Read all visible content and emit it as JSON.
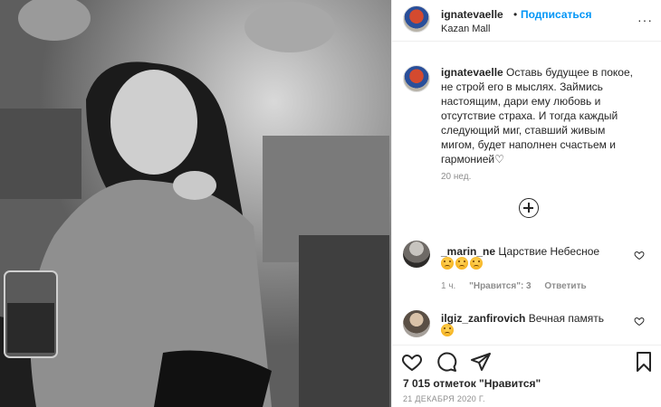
{
  "post": {
    "username": "ignatevaelle",
    "separator": "•",
    "follow_label": "Подписаться",
    "location": "Kazan Mall",
    "more_label": "···"
  },
  "caption": {
    "username": "ignatevaelle",
    "text": "Оставь будущее в покое, не строй его в мыслях. Займись настоящим, дари ему любовь и отсутствие страха. И тогда каждый следующий миг, ставший живым мигом, будет наполнен счастьем и гармонией♡",
    "time": "20 нед."
  },
  "comments": [
    {
      "username": "_marin_ne",
      "text": "Царствие Небесное",
      "emoji": [
        "sad-face",
        "sad-face",
        "sad-face"
      ],
      "time": "1 ч.",
      "likes_label": "\"Нравится\": 3",
      "reply_label": "Ответить"
    },
    {
      "username": "ilgiz_zanfirovich",
      "text": "Вечная память",
      "emoji": [
        "sad-face"
      ]
    }
  ],
  "likes_text": "7 015 отметок \"Нравится\"",
  "date_text": "21 ДЕКАБРЯ 2020 Г.",
  "colors": {
    "accent": "#0095f6",
    "text": "#262626",
    "muted": "#8e8e8e",
    "border": "#efefef"
  }
}
